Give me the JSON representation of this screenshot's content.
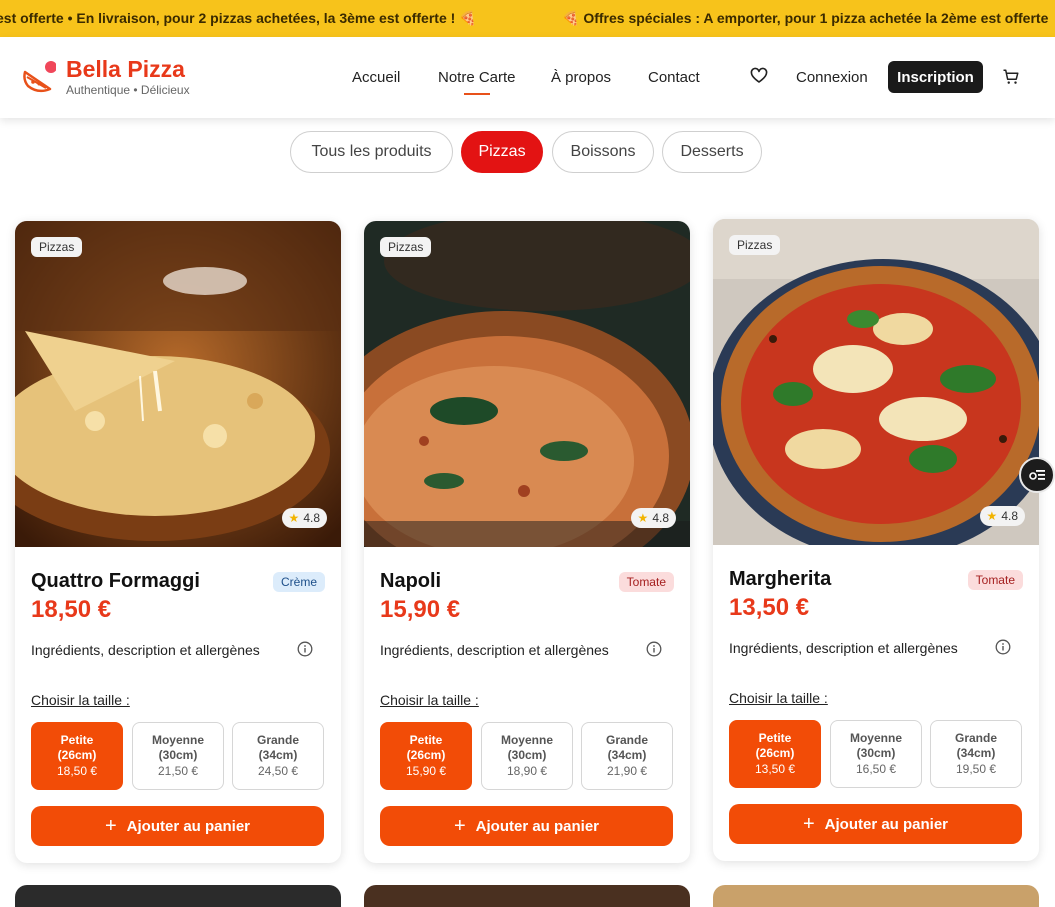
{
  "promo": {
    "text_left": "est offerte • En livraison, pour 2 pizzas achetées, la 3ème est offerte ! 🍕",
    "text_right": "🍕 Offres spéciales : A emporter, pour 1 pizza achetée la 2ème est offerte"
  },
  "brand": {
    "name": "Bella Pizza",
    "tagline": "Authentique • Délicieux",
    "color": "#e8391a"
  },
  "nav": {
    "items": [
      "Accueil",
      "Notre Carte",
      "À propos",
      "Contact"
    ],
    "active": "Notre Carte",
    "login_label": "Connexion",
    "signup_label": "Inscription"
  },
  "filters": {
    "items": [
      "Tous les produits",
      "Pizzas",
      "Boissons",
      "Desserts"
    ],
    "active": "Pizzas",
    "active_color": "#e31313"
  },
  "products": [
    {
      "category": "Pizzas",
      "rating": "4.8",
      "name": "Quattro Formaggi",
      "type": "Crème",
      "price": "18,50 €",
      "description_label": "Ingrédients, description et allergènes",
      "size_label": "Choisir la taille :",
      "sizes": [
        {
          "line1": "Petite",
          "line2": "(26cm)",
          "price": "18,50 €",
          "selected": true
        },
        {
          "line1": "Moyenne",
          "line2": "(30cm)",
          "price": "21,50 €",
          "selected": false
        },
        {
          "line1": "Grande",
          "line2": "(34cm)",
          "price": "24,50 €",
          "selected": false
        }
      ],
      "add_label": "Ajouter au panier"
    },
    {
      "category": "Pizzas",
      "rating": "4.8",
      "name": "Napoli",
      "type": "Tomate",
      "price": "15,90 €",
      "description_label": "Ingrédients, description et allergènes",
      "size_label": "Choisir la taille :",
      "sizes": [
        {
          "line1": "Petite",
          "line2": "(26cm)",
          "price": "15,90 €",
          "selected": true
        },
        {
          "line1": "Moyenne",
          "line2": "(30cm)",
          "price": "18,90 €",
          "selected": false
        },
        {
          "line1": "Grande",
          "line2": "(34cm)",
          "price": "21,90 €",
          "selected": false
        }
      ],
      "add_label": "Ajouter au panier"
    },
    {
      "category": "Pizzas",
      "rating": "4.8",
      "name": "Margherita",
      "type": "Tomate",
      "price": "13,50 €",
      "description_label": "Ingrédients, description et allergènes",
      "size_label": "Choisir la taille :",
      "sizes": [
        {
          "line1": "Petite",
          "line2": "(26cm)",
          "price": "13,50 €",
          "selected": true
        },
        {
          "line1": "Moyenne",
          "line2": "(30cm)",
          "price": "16,50 €",
          "selected": false
        },
        {
          "line1": "Grande",
          "line2": "(34cm)",
          "price": "19,50 €",
          "selected": false
        }
      ],
      "add_label": "Ajouter au panier"
    }
  ],
  "colors": {
    "accent": "#f24c07",
    "promo_bar": "#f7c31b",
    "signup_bg": "#1a1a1a"
  }
}
